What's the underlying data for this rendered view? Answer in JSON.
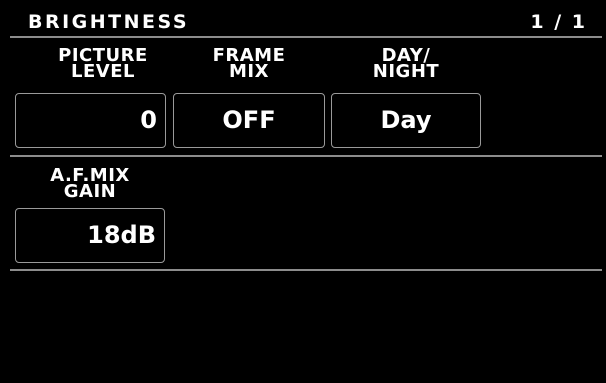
{
  "header": {
    "title": "BRIGHTNESS",
    "page_indicator": "1 / 1"
  },
  "items": {
    "picture_level": {
      "label_line1": "PICTURE",
      "label_line2": "LEVEL",
      "value": "0"
    },
    "frame_mix": {
      "label_line1": "FRAME",
      "label_line2": "MIX",
      "value": "OFF"
    },
    "day_night": {
      "label_line1": "DAY/",
      "label_line2": "NIGHT",
      "value": "Day"
    },
    "af_mix_gain": {
      "label_line1": "A.F.MIX",
      "label_line2": "GAIN",
      "value": "18dB"
    }
  },
  "colors": {
    "background": "#000000",
    "text": "#ffffff",
    "box_border": "#9a9a9a",
    "divider": "#8c8c8c"
  }
}
